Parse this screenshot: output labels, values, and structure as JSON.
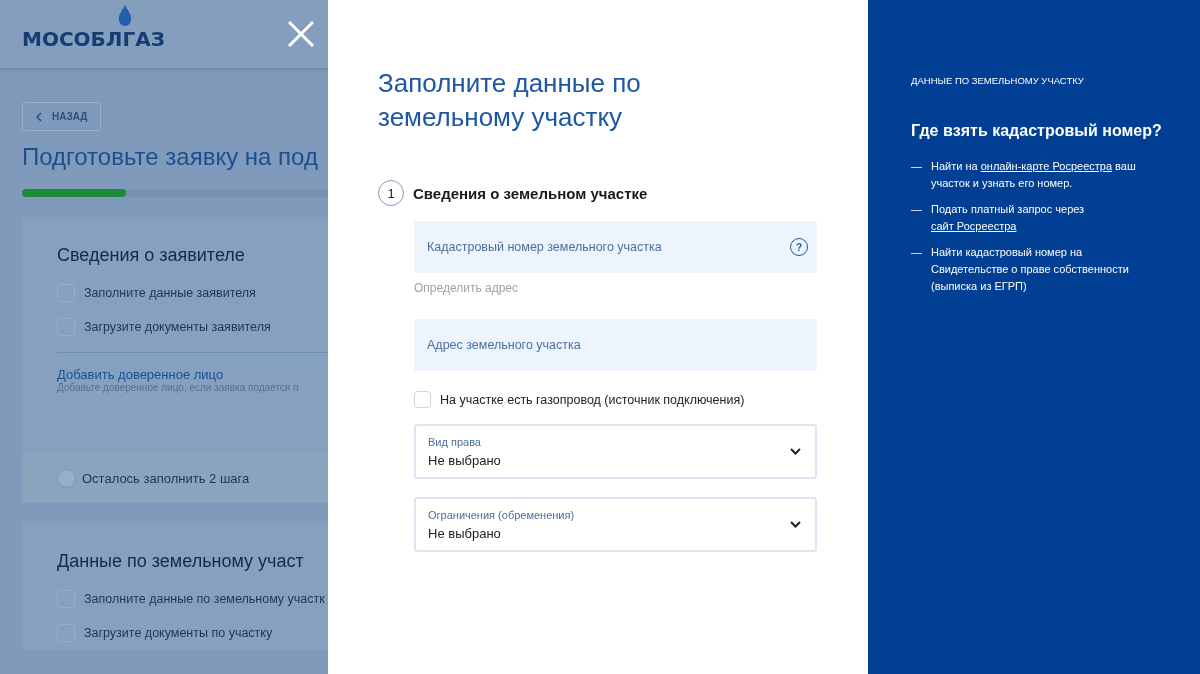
{
  "background_page": {
    "logo": "МОСОБЛГАЗ",
    "back_button": "НАЗАД",
    "title": "Подготовьте заявку на под",
    "progress": {
      "level": 0.34
    },
    "sections": [
      {
        "title": "Сведения о заявителе",
        "tasks": [
          {
            "label": "Заполните данные заявителя",
            "checked": false
          },
          {
            "label": "Загрузите документы заявителя",
            "checked": false
          }
        ],
        "link": "Добавить доверенное лицо",
        "link_hint": "Добавьте доверенное лицо, если заявка подается п",
        "status": "Осталось заполнить 2 шага"
      },
      {
        "title": "Данные по земельному участ",
        "tasks": [
          {
            "label": "Заполните данные по земельному участк",
            "checked": false
          },
          {
            "label": "Загрузите документы по участку",
            "checked": false
          }
        ]
      }
    ]
  },
  "dialog": {
    "title": "Заполните данные по земельному участку",
    "step": {
      "number": "1",
      "title": "Сведения о земельном участке"
    },
    "fields": [
      {
        "kind": "input",
        "placeholder": "Кадастровый номер земельного участка",
        "help": "?",
        "hint": "Определить адрес"
      },
      {
        "kind": "input",
        "placeholder": "Адрес земельного участка"
      },
      {
        "kind": "checkbox",
        "label": "На участке есть газопровод (источник подключения)",
        "checked": false
      },
      {
        "kind": "select",
        "label": "Вид права",
        "value": "Не выбрано"
      },
      {
        "kind": "select",
        "label": "Ограничения (обременения)",
        "value": "Не выбрано"
      }
    ]
  },
  "help_panel": {
    "eyebrow": "ДАННЫЕ ПО ЗЕМЕЛЬНОМУ УЧАСТКУ",
    "title": "Где взять кадастровый номер?",
    "dash": "—",
    "items": [
      {
        "before": "Найти на",
        "link": "онлайн-карте Росреестра",
        "after": "ваш участок и узнать его номер."
      },
      {
        "before": "Подать платный запрос через",
        "link": "сайт Росреестра"
      },
      {
        "before": "Найти кадастровый номер на Свидетельстве о праве собственности (выписка из ЕГРП)"
      }
    ]
  }
}
